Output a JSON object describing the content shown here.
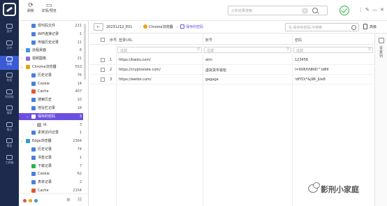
{
  "rail": {
    "items": [
      {
        "label": "案件"
      },
      {
        "label": "文件"
      },
      {
        "label": "分析"
      },
      {
        "label": "检索"
      },
      {
        "label": "时间线"
      },
      {
        "label": "搜索"
      },
      {
        "label": "笔记"
      },
      {
        "label": "报告"
      },
      {
        "label": "工具箱"
      }
    ]
  },
  "toolbar": {
    "refresh_label": "刷新",
    "detail_label": "详情/预览",
    "search_placeholder": "分析结果搜索",
    "window_icons": [
      "⋮",
      "✎",
      "—",
      "✕"
    ]
  },
  "tree": {
    "nodes": [
      {
        "label": "现代码文件",
        "count": "221",
        "icon": "#4a7fe0",
        "indent": 3
      },
      {
        "label": "WiFi连接记录",
        "count": "1",
        "icon": "#4a7fe0",
        "indent": 3
      },
      {
        "label": "传输历史记录",
        "count": "11",
        "icon": "#4a7fe0",
        "indent": 3
      },
      {
        "label": "远程桌面",
        "count": "6",
        "icon": "#3a9ad9",
        "indent": 2,
        "arrow": "›"
      },
      {
        "label": "视频图像",
        "count": "21",
        "icon": "#8a6fd0",
        "indent": 2,
        "arrow": "›"
      },
      {
        "label": "Chrome浏览器",
        "count": "553",
        "icon": "#e8a21a",
        "indent": 2,
        "arrow": "⌄"
      },
      {
        "label": "历史记录",
        "count": "76",
        "icon": "#4a7fe0",
        "indent": 3
      },
      {
        "label": "Cookie",
        "count": "14",
        "icon": "#4a7fe0",
        "indent": 3
      },
      {
        "label": "Cache",
        "count": "407",
        "icon": "#e0573a",
        "indent": 3
      },
      {
        "label": "搜索历史",
        "count": "10",
        "icon": "#4a7fe0",
        "indent": 3
      },
      {
        "label": "地址栏记录",
        "count": "18",
        "icon": "#4a7fe0",
        "indent": 3
      },
      {
        "label": "保存的密码",
        "count": "3",
        "icon": "#ffffff",
        "indent": 3,
        "arrow": "⌄",
        "selected": true
      },
      {
        "label": "ld",
        "count": "3",
        "icon": "#aaaaaa",
        "indent": 4,
        "arrow": "›"
      },
      {
        "label": "素常访问记录",
        "count": "1",
        "icon": "#4a7fe0",
        "indent": 3
      },
      {
        "label": "Edge浏览器",
        "count": "2364",
        "icon": "#2b9fd0",
        "indent": 2,
        "arrow": "⌄"
      },
      {
        "label": "历史记录",
        "count": "74",
        "icon": "#4a7fe0",
        "indent": 3
      },
      {
        "label": "书签记录",
        "count": "1",
        "icon": "#4a7fe0",
        "indent": 3
      },
      {
        "label": "下载记录",
        "count": "7",
        "icon": "#2eb04a",
        "indent": 3
      },
      {
        "label": "Cookie",
        "count": "62",
        "icon": "#4a7fe0",
        "indent": 3
      },
      {
        "label": "表单记录",
        "count": "2",
        "icon": "#4a7fe0",
        "indent": 3
      },
      {
        "label": "Cache",
        "count": "2154",
        "icon": "#e0573a",
        "indent": 3
      }
    ],
    "status_dots": [
      "#e0573a",
      "#e8a21a",
      "#3a9ad9"
    ]
  },
  "pathbar": {
    "crumbs": [
      "20231212_E01",
      "Chrome浏览器",
      "保存的密码"
    ],
    "search_placeholder": "在 保存的密码 中搜索",
    "advanced_label": "高级"
  },
  "table": {
    "headers": [
      "序号",
      "登录URL",
      "账号",
      "密码"
    ],
    "filter_placeholder": "过滤",
    "rows": [
      {
        "no": "1",
        "url": "https://baidu.com/",
        "account": "atm",
        "password": "123456"
      },
      {
        "no": "2",
        "url": "https://cryptoslate.com/",
        "account": "虚拟货币钱包",
        "password": "l=9V8/hNRID^)d89"
      },
      {
        "no": "3",
        "url": "https://weibo.com/",
        "account": "gagaga",
        "password": "!dfYD(*&j98_jUe8"
      }
    ]
  },
  "right_panel": {
    "label": "设置列"
  },
  "watermark": {
    "text": "影刑小家庭"
  }
}
